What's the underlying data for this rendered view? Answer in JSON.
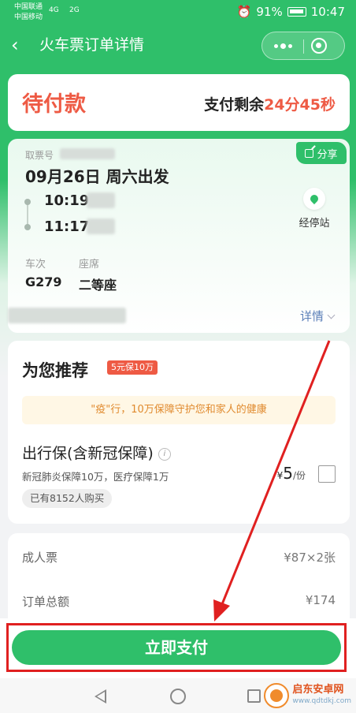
{
  "status_bar": {
    "carrier1": "中国联通",
    "carrier2": "中国移动",
    "signal1": "4G",
    "signal2": "2G",
    "battery": "91%",
    "time": "10:47"
  },
  "nav": {
    "title": "火车票订单详情"
  },
  "payment": {
    "status": "待付款",
    "countdown_label": "支付剩余",
    "countdown": "24分45秒"
  },
  "ticket": {
    "share_label": "分享",
    "pickup_label": "取票号",
    "departure_date": "09月26日 周六出发",
    "depart_time": "10:19",
    "arrive_time": "11:17",
    "stops_label": "经停站",
    "train_label": "车次",
    "train_no": "G279",
    "seat_label": "座席",
    "seat_class": "二等座",
    "details_label": "详情"
  },
  "recommend": {
    "title": "为您推荐",
    "badge": "5元保10万",
    "banner": "\"疫\"行，10万保障守护您和家人的健康",
    "product_name": "出行保(含新冠保障)",
    "info_glyph": "i",
    "product_desc": "新冠肺炎保障10万，医疗保障1万",
    "bought": "已有8152人购买",
    "price_symbol": "¥",
    "price": "5",
    "price_unit": "/份"
  },
  "totals": {
    "adult_label": "成人票",
    "adult_value": "¥87×2张",
    "total_label": "订单总额",
    "total_value": "¥174"
  },
  "pay_button": {
    "label": "立即支付"
  },
  "watermark": {
    "cn": "启东安卓网",
    "en": "www.qdtdkj.com"
  }
}
